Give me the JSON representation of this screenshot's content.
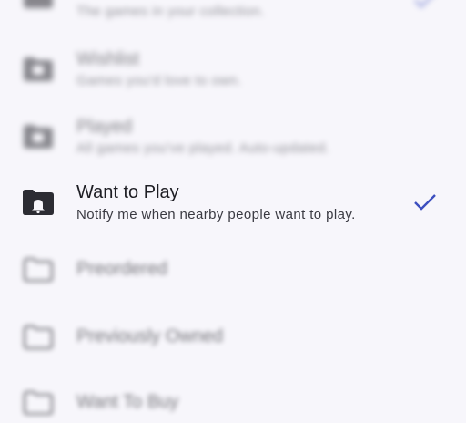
{
  "colors": {
    "accent": "#3d4fbf",
    "text": "#1e1e24",
    "subtext": "#3a3a42",
    "icon": "#2c2c33"
  },
  "items": [
    {
      "title": "",
      "subtitle": "The games in your collection.",
      "icon": "folder-game-icon",
      "checked": true
    },
    {
      "title": "Wishlist",
      "subtitle": "Games you'd love to own.",
      "icon": "folder-game-icon",
      "checked": false
    },
    {
      "title": "Played",
      "subtitle": "All games you've played. Auto-updated.",
      "icon": "folder-game-icon",
      "checked": false
    },
    {
      "title": "Want to Play",
      "subtitle": "Notify me when nearby people want to play.",
      "icon": "folder-bell-icon",
      "checked": true
    },
    {
      "title": "Preordered",
      "subtitle": "",
      "icon": "folder-outline-icon",
      "checked": false
    },
    {
      "title": "Previously Owned",
      "subtitle": "",
      "icon": "folder-outline-icon",
      "checked": false
    },
    {
      "title": "Want To Buy",
      "subtitle": "",
      "icon": "folder-outline-icon",
      "checked": false
    }
  ]
}
